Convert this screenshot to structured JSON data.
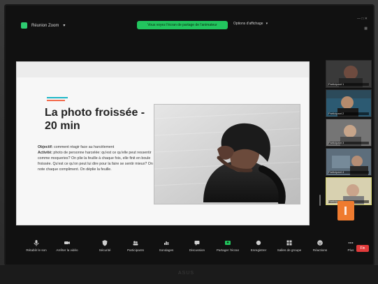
{
  "topbar": {
    "meeting_label": "Réunion Zoom",
    "share_banner": "Vous voyez l'écran de partage de l'animateur",
    "view_options": "Options d'affichage"
  },
  "slide": {
    "title": "La photo froissée - 20 min",
    "body_objective_label": "Objectif:",
    "body_objective_text": "comment réagir face au harcèlement",
    "body_activity_label": "Activité:",
    "body_activity_text": "photo de personne harcelée: qu'est ce qu'elle peut ressentir comme moqueries? On plie la feuille à chaque fois, elle finit en boule froissée. Qu'est ce qu'on peut lui dire pour la faire se sentir mieux? On note chaque compliment. On déplie la feuille."
  },
  "gallery": {
    "tiles": [
      {
        "name": "Participant 1"
      },
      {
        "name": "Participant 2"
      },
      {
        "name": "Participant 3"
      },
      {
        "name": "Participant 4"
      },
      {
        "name": "Participant 5"
      }
    ]
  },
  "toolbar": {
    "items": [
      {
        "label": "Rétablir le son"
      },
      {
        "label": "Arrêter la vidéo"
      },
      {
        "label": "Sécurité"
      },
      {
        "label": "Participants"
      },
      {
        "label": "Sondages"
      },
      {
        "label": "Discussion"
      },
      {
        "label": "Partager l'écran"
      },
      {
        "label": "Enregistrer"
      },
      {
        "label": "Salles de groupe"
      },
      {
        "label": "Réactions"
      },
      {
        "label": "Plus"
      }
    ],
    "end_label": "Fin"
  },
  "device": {
    "brand": "ASUS"
  },
  "colors": {
    "green": "#22c55e",
    "accent_teal": "#1db7c7",
    "accent_coral": "#f36d4f",
    "end_red": "#e23b3b",
    "orange": "#ef7b2f"
  }
}
